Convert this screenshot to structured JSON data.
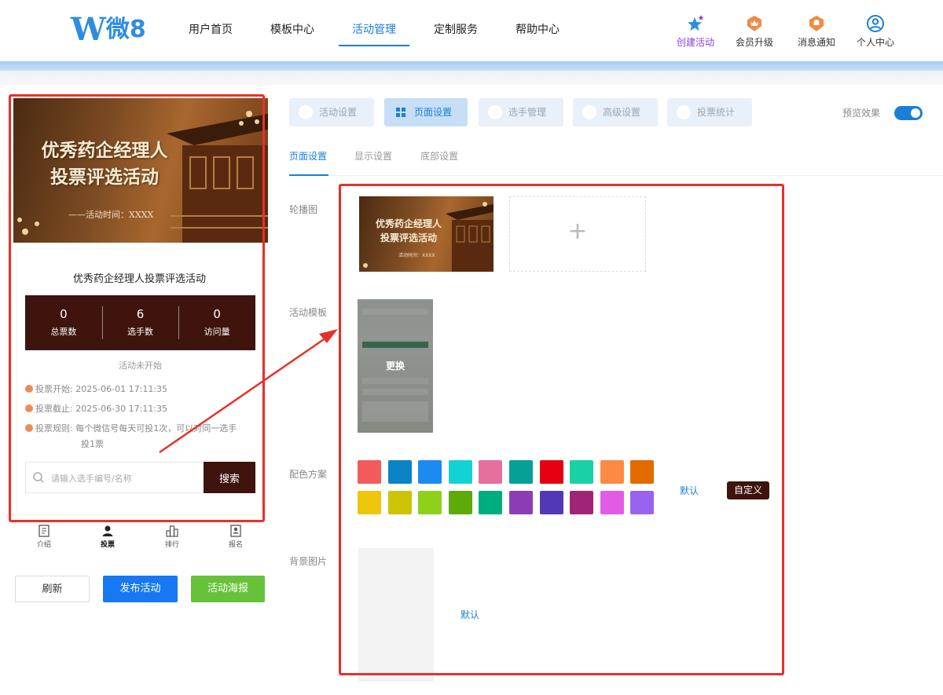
{
  "header": {
    "logo_text": "微8",
    "nav": [
      {
        "label": "用户首页"
      },
      {
        "label": "模板中心"
      },
      {
        "label": "活动管理"
      },
      {
        "label": "定制服务"
      },
      {
        "label": "帮助中心"
      }
    ],
    "active_nav": "活动管理",
    "tools": [
      {
        "label": "创建活动",
        "icon": "stars-icon"
      },
      {
        "label": "会员升级",
        "icon": "crown-badge-icon"
      },
      {
        "label": "消息通知",
        "icon": "bell-badge-icon"
      },
      {
        "label": "个人中心",
        "icon": "user-circle-icon"
      }
    ]
  },
  "preview": {
    "banner_title_line1": "优秀药企经理人",
    "banner_title_line2": "投票评选活动",
    "banner_subtitle": "——活动时间：XXXX",
    "activity_title": "优秀药企经理人投票评选活动",
    "stats": [
      {
        "value": "0",
        "label": "总票数"
      },
      {
        "value": "6",
        "label": "选手数"
      },
      {
        "value": "0",
        "label": "访问量"
      }
    ],
    "status": "活动未开始",
    "vote_start_label": "投票开始:",
    "vote_start": "2025-06-01 17:11:35",
    "vote_end_label": "投票截止:",
    "vote_end": "2025-06-30 17:11:35",
    "vote_rule_label": "投票规则:",
    "vote_rule_line1": "每个微信号每天可投1次，可以对同一选手",
    "vote_rule_line2": "投1票",
    "search_placeholder": "请输入选手编号/名称",
    "search_button": "搜索",
    "tabbar": [
      {
        "label": "介绍"
      },
      {
        "label": "投票"
      },
      {
        "label": "排行"
      },
      {
        "label": "报名"
      }
    ]
  },
  "actions": {
    "refresh": "刷新",
    "publish": "发布活动",
    "poster": "活动海报"
  },
  "settings": {
    "tabs": [
      {
        "label": "活动设置"
      },
      {
        "label": "页面设置"
      },
      {
        "label": "选手管理"
      },
      {
        "label": "高级设置"
      },
      {
        "label": "投票统计"
      }
    ],
    "active_tab": "页面设置",
    "preview_label": "预览效果",
    "preview_enabled": true,
    "subtabs": [
      {
        "label": "页面设置"
      },
      {
        "label": "显示设置"
      },
      {
        "label": "底部设置"
      }
    ],
    "carousel_label": "轮播图",
    "carousel_thumb_line1": "优秀药企经理人",
    "carousel_thumb_line2": "投票评选活动",
    "carousel_thumb_sub": "活动时间：XXXX",
    "add_symbol": "+",
    "template_label": "活动模板",
    "template_change": "更换",
    "color_label": "配色方案",
    "colors": [
      "#f25b5b",
      "#0a84c6",
      "#1c8bf1",
      "#13d2d6",
      "#e66f9e",
      "#06a096",
      "#e60012",
      "#1ad1a5",
      "#fd8a44",
      "#e36a00",
      "#eec60c",
      "#cdc406",
      "#8fd11a",
      "#5faa0b",
      "#00ad7c",
      "#8c3cb5",
      "#5238b4",
      "#a02577",
      "#e25be5",
      "#9a63ef"
    ],
    "color_default": "默认",
    "color_custom": "自定义",
    "bg_label": "背景图片",
    "bg_default": "默认"
  }
}
